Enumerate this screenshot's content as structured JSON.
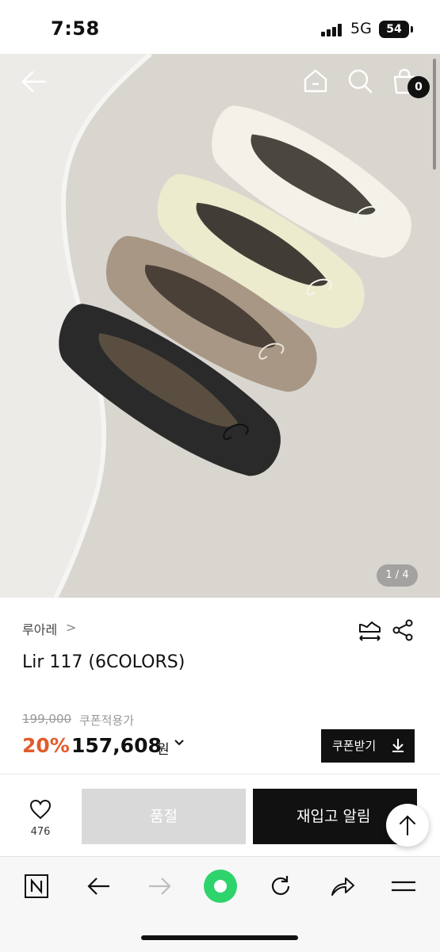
{
  "status_bar": {
    "time": "7:58",
    "network": "5G",
    "battery": "54"
  },
  "hero": {
    "pager_text": "1 / 4",
    "cart_count": "0",
    "icons": {
      "back": "arrow-left-icon",
      "home": "home-icon",
      "search": "search-icon",
      "cart": "shopping-bag-icon"
    }
  },
  "product": {
    "brand": "루아레",
    "brand_chevron": ">",
    "name": "Lir 117 (6COLORS)",
    "original_price": "199,000",
    "coupon_price_label": "쿠폰적용가",
    "discount": "20%",
    "price": "157,608",
    "currency": "원",
    "coupon_button": "쿠폰받기"
  },
  "actions": {
    "like_count": "476",
    "soldout_label": "품절",
    "restock_label": "재입고 알림"
  },
  "browser_bar": {
    "icons": [
      "naver-icon",
      "back-arrow-icon",
      "forward-arrow-icon",
      "green-dot-icon",
      "refresh-icon",
      "share-icon",
      "menu-icon"
    ]
  },
  "colors": {
    "discount": "#e35b2c",
    "dark": "#111111",
    "soldout_bg": "#d9d9d9",
    "green": "#2fd36b"
  }
}
